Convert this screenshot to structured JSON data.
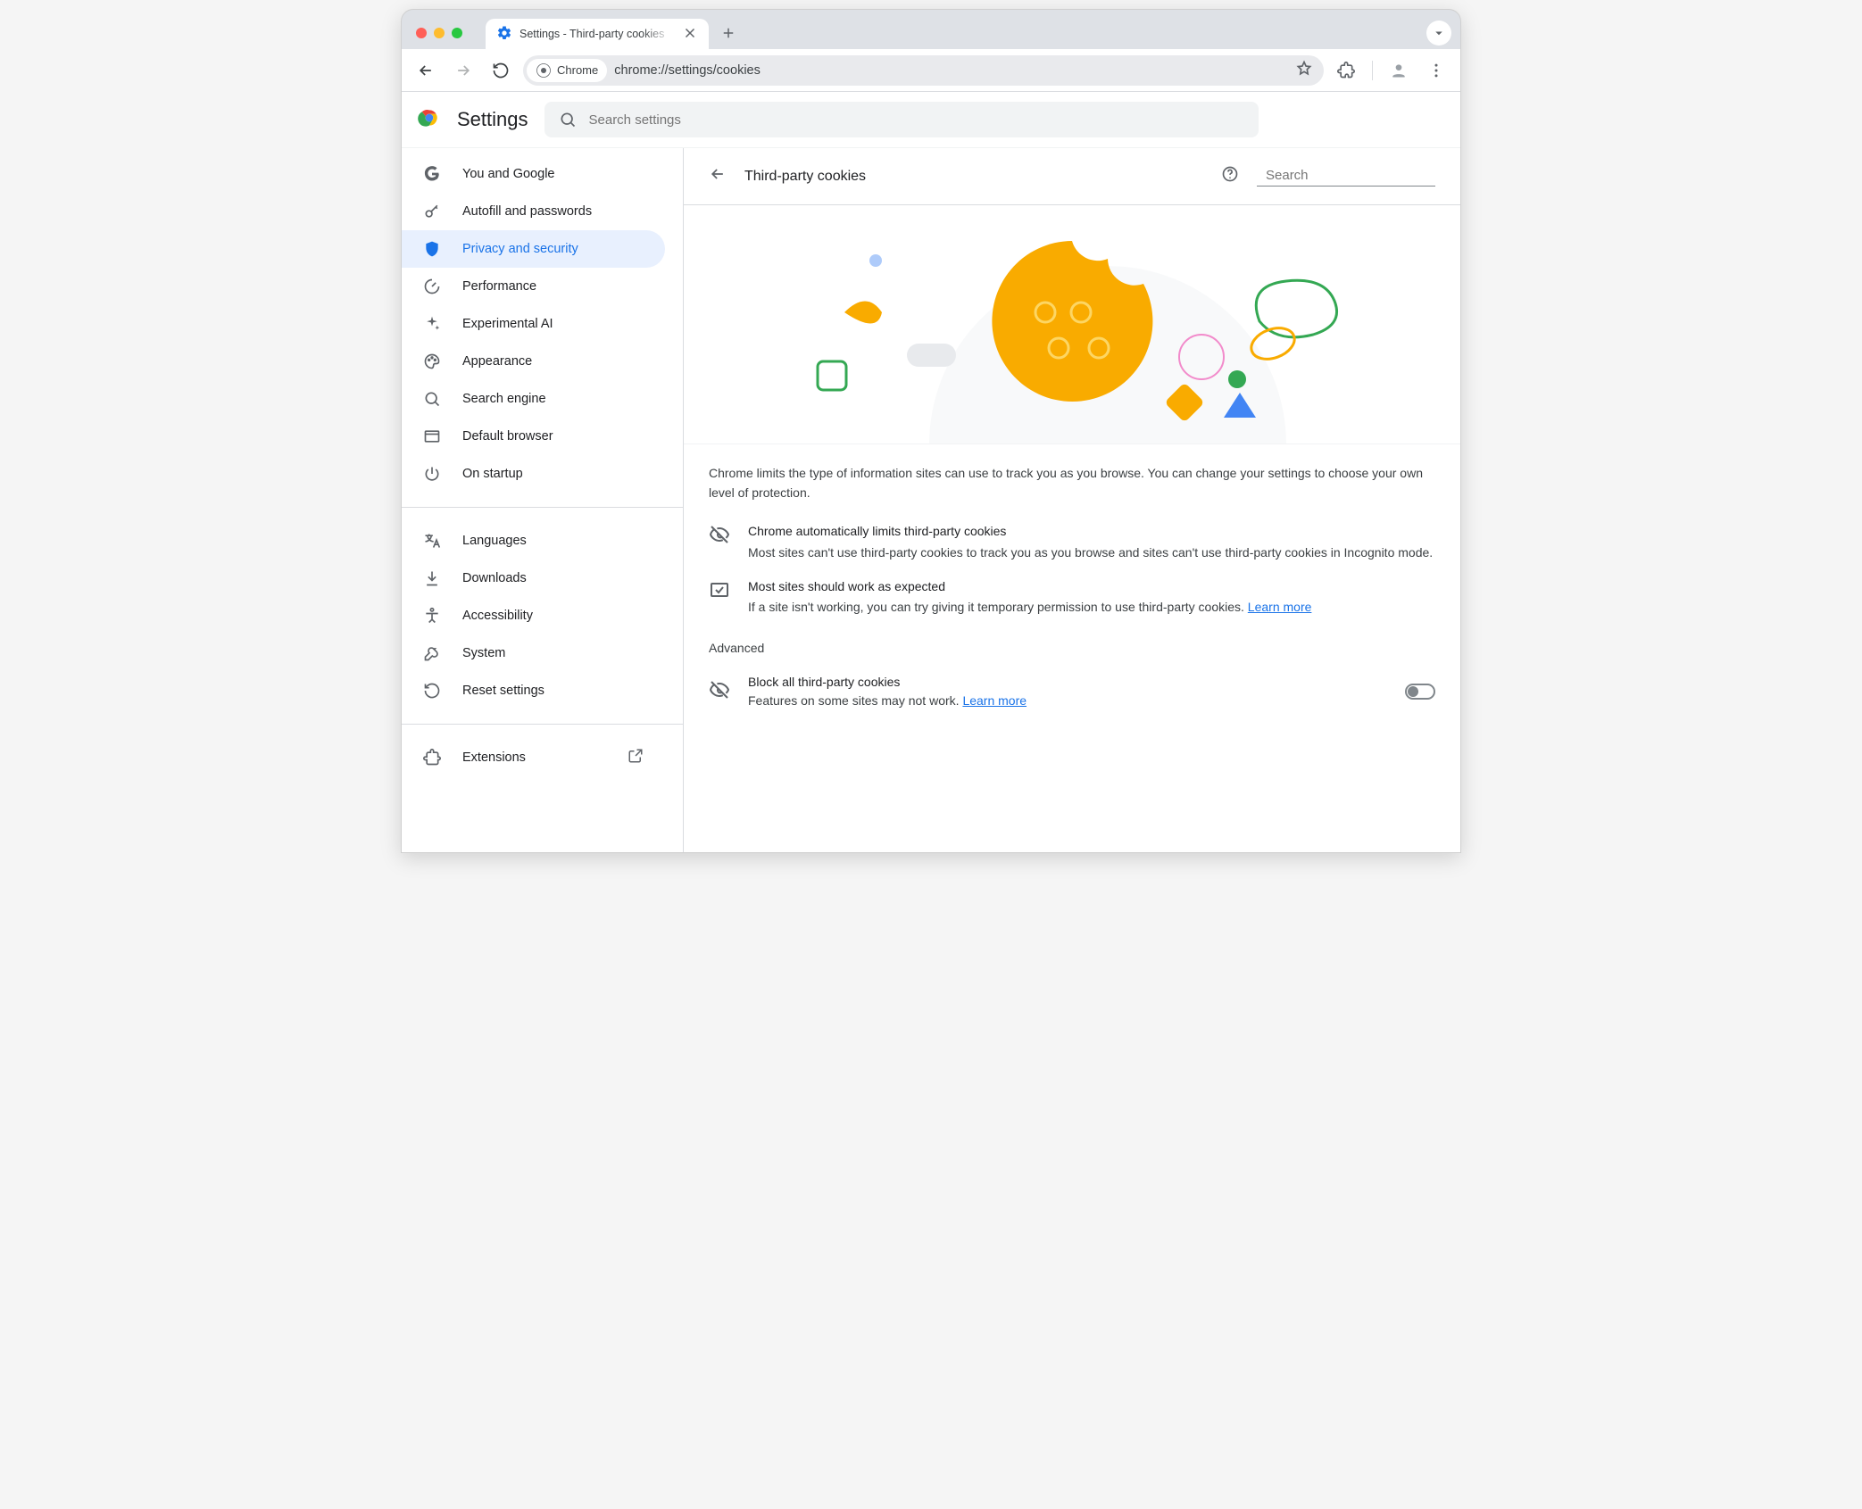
{
  "browser": {
    "tab_title": "Settings - Third-party cookies",
    "omnibox_chip": "Chrome",
    "url": "chrome://settings/cookies"
  },
  "app": {
    "title": "Settings",
    "search_placeholder": "Search settings"
  },
  "sidebar": {
    "primary": [
      {
        "label": "You and Google"
      },
      {
        "label": "Autofill and passwords"
      },
      {
        "label": "Privacy and security"
      },
      {
        "label": "Performance"
      },
      {
        "label": "Experimental AI"
      },
      {
        "label": "Appearance"
      },
      {
        "label": "Search engine"
      },
      {
        "label": "Default browser"
      },
      {
        "label": "On startup"
      }
    ],
    "secondary": [
      {
        "label": "Languages"
      },
      {
        "label": "Downloads"
      },
      {
        "label": "Accessibility"
      },
      {
        "label": "System"
      },
      {
        "label": "Reset settings"
      }
    ],
    "tertiary": [
      {
        "label": "Extensions"
      }
    ]
  },
  "page": {
    "title": "Third-party cookies",
    "search_placeholder": "Search",
    "intro": "Chrome limits the type of information sites can use to track you as you browse. You can change your settings to choose your own level of protection.",
    "info1_title": "Chrome automatically limits third-party cookies",
    "info1_body": "Most sites can't use third-party cookies to track you as you browse and sites can't use third-party cookies in Incognito mode.",
    "info2_title": "Most sites should work as expected",
    "info2_body": "If a site isn't working, you can try giving it temporary permission to use third-party cookies.",
    "learn_more": "Learn more",
    "advanced_heading": "Advanced",
    "block_all_title": "Block all third-party cookies",
    "block_all_body": "Features on some sites may not work. "
  }
}
